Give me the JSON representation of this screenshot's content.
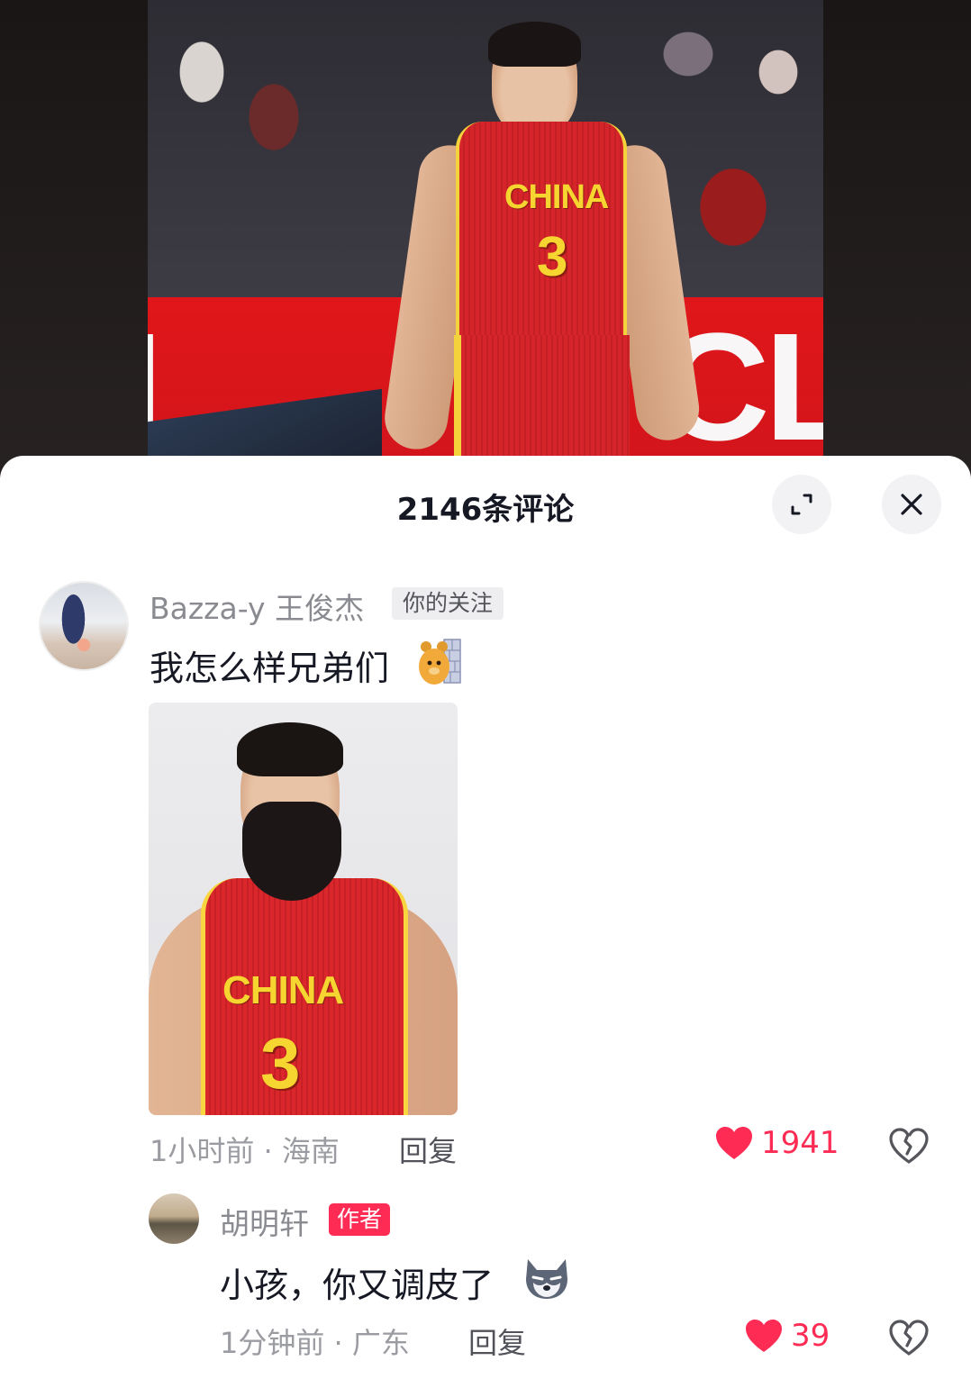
{
  "video": {
    "jersey_text": "CHINA",
    "jersey_number": "3",
    "ad_board_text": "TCL",
    "ad_board_left_text": "L"
  },
  "sheet": {
    "title": "2146条评论",
    "expand_icon": "expand-icon",
    "close_icon": "close-icon"
  },
  "comments": [
    {
      "username": "Bazza-y 王俊杰",
      "badge": "你的关注",
      "text": "我怎么样兄弟们",
      "emoji": "bear-emoji",
      "image": {
        "jersey_text": "CHINA",
        "jersey_number": "3"
      },
      "meta": "1小时前 · 海南",
      "reply_label": "回复",
      "likes": "1941",
      "liked": true
    },
    {
      "username": "胡明轩",
      "badge": "作者",
      "text": "小孩，你又调皮了",
      "emoji": "wolf-emoji",
      "meta": "1分钟前 · 广东",
      "reply_label": "回复",
      "likes": "39",
      "liked": true
    }
  ],
  "colors": {
    "like_red": "#fe2c55",
    "author_badge": "#fe2c55",
    "text_primary": "#161823",
    "text_secondary": "#9b9ca1"
  }
}
